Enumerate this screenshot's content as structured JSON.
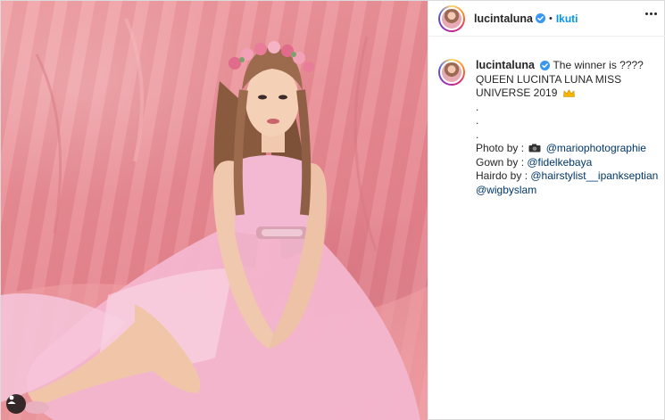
{
  "post": {
    "username": "lucintaluna",
    "separator": "•",
    "follow_label": "Ikuti",
    "more_icon": "more-options-icon",
    "verified_icon": "verified-badge-icon",
    "accent_color": "#0095f6",
    "mention_color": "#00376b"
  },
  "caption": {
    "username": "lucintaluna",
    "line1": "The winner is ????",
    "line2": "QUEEN LUCINTA LUNA MISS",
    "line3": "UNIVERSE 2019",
    "crown_icon": "crown-emoji-icon",
    "dot1": ".",
    "dot2": ".",
    "dot3": ".",
    "photo_label": "Photo by :",
    "camera_icon": "camera-emoji-icon",
    "photo_mention": "@mariophotographie",
    "gown_label": "Gown by :",
    "gown_mention": "@fidelkebaya",
    "hair_label": "Hairdo by :",
    "hair_mention": "@hairstylist__ipankseptian",
    "wig_mention": "@wigbyslam"
  },
  "photo": {
    "user_tag_icon": "user-tag-icon",
    "backdrop_color": "#e98d95",
    "dress_color": "#f3b6cf"
  }
}
